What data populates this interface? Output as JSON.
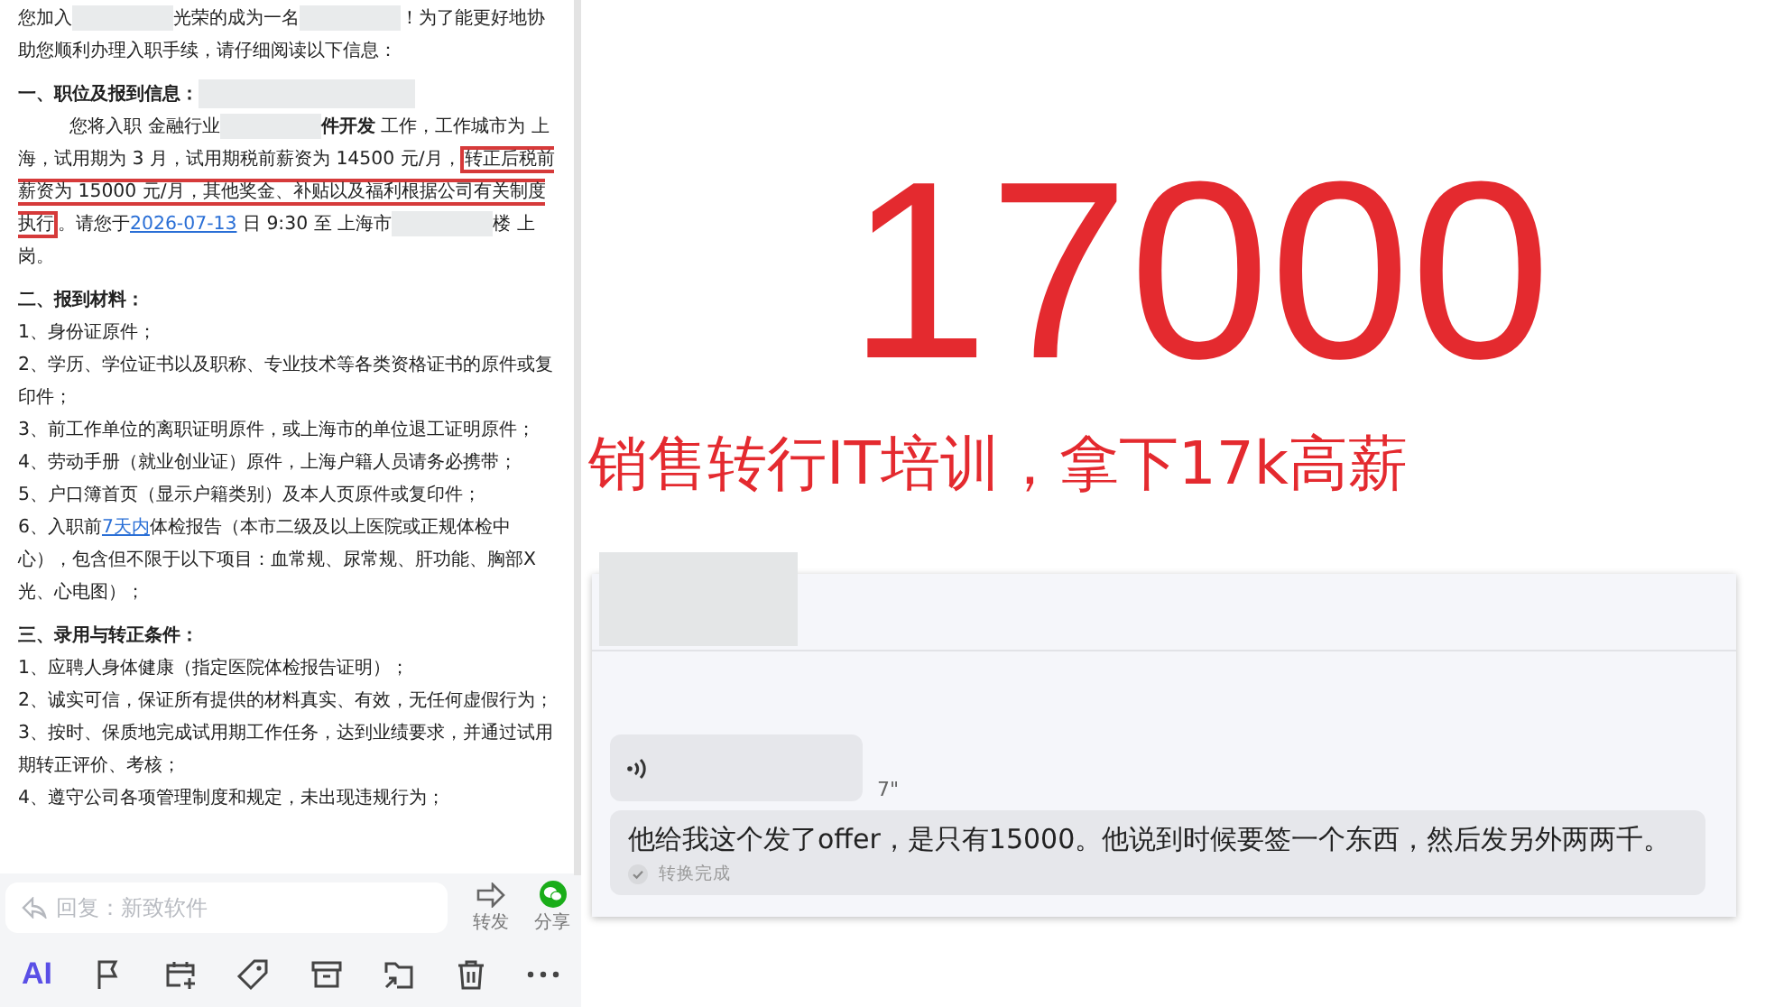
{
  "email": {
    "blocks": [
      {
        "kind": "para",
        "parts": [
          {
            "kind": "text",
            "text": "您加入"
          },
          {
            "kind": "redacted"
          },
          {
            "kind": "text",
            "text": "光荣的成为一名"
          },
          {
            "kind": "redacted"
          },
          {
            "kind": "text",
            "text": "！为了能更好地协助您顺利办理入职手续，请仔细阅读以下信息："
          }
        ]
      },
      {
        "kind": "heading",
        "parts": [
          {
            "kind": "text",
            "text": "一、职位及报到信息："
          },
          {
            "kind": "redacted"
          }
        ]
      },
      {
        "kind": "indented",
        "parts": [
          {
            "kind": "text",
            "text": "您将入职 金融行业"
          },
          {
            "kind": "redacted"
          },
          {
            "kind": "text",
            "text": "**件开发** 工作，工作城市为 上海，试用期为 3 月，试用期税前薪资为 14500 元/月，"
          },
          {
            "kind": "highlight",
            "text": "转正后税前薪资为 15000 元/月，其他奖金、补贴以及福利根据公司有关制度执行"
          },
          {
            "kind": "text",
            "text": "。请您于"
          },
          {
            "kind": "link",
            "text": "2026-07-13"
          },
          {
            "kind": "text",
            "text": " 日 9:30 至 上海市"
          },
          {
            "kind": "redacted"
          },
          {
            "kind": "text",
            "text": "楼 上岗。"
          }
        ]
      },
      {
        "kind": "heading",
        "parts": [
          {
            "kind": "text",
            "text": "二、报到材料："
          }
        ]
      },
      {
        "kind": "item",
        "parts": [
          {
            "kind": "text",
            "text": "1、身份证原件；"
          }
        ]
      },
      {
        "kind": "item",
        "parts": [
          {
            "kind": "text",
            "text": "2、学历、学位证书以及职称、专业技术等各类资格证书的原件或复印件；"
          }
        ]
      },
      {
        "kind": "item",
        "parts": [
          {
            "kind": "text",
            "text": "3、前工作单位的离职证明原件，或上海市的单位退工证明原件；"
          }
        ]
      },
      {
        "kind": "item",
        "parts": [
          {
            "kind": "text",
            "text": "4、劳动手册（就业创业证）原件，上海户籍人员请务必携带；"
          }
        ]
      },
      {
        "kind": "item",
        "parts": [
          {
            "kind": "text",
            "text": "5、户口簿首页（显示户籍类别）及本人页原件或复印件；"
          }
        ]
      },
      {
        "kind": "item",
        "parts": [
          {
            "kind": "text",
            "text": "6、入职前"
          },
          {
            "kind": "link",
            "text": "7天内"
          },
          {
            "kind": "text",
            "text": "体检报告（本市二级及以上医院或正规体检中心），包含但不限于以下项目：血常规、尿常规、肝功能、胸部X光、心电图）；"
          }
        ]
      },
      {
        "kind": "heading",
        "parts": [
          {
            "kind": "text",
            "text": "三、录用与转正条件："
          }
        ]
      },
      {
        "kind": "item",
        "parts": [
          {
            "kind": "text",
            "text": "1、应聘人身体健康（指定医院体检报告证明）；"
          }
        ]
      },
      {
        "kind": "item",
        "parts": [
          {
            "kind": "text",
            "text": "2、诚实可信，保证所有提供的材料真实、有效，无任何虚假行为；"
          }
        ]
      },
      {
        "kind": "item",
        "parts": [
          {
            "kind": "text",
            "text": "3、按时、保质地完成试用期工作任务，达到业绩要求，并通过试用期转正评价、考核；"
          }
        ]
      },
      {
        "kind": "item",
        "parts": [
          {
            "kind": "text",
            "text": "4、遵守公司各项管理制度和规定，未出现违规行为；"
          }
        ]
      }
    ]
  },
  "reply": {
    "placeholder": "回复：新致软件"
  },
  "actions": [
    {
      "kind": "forward",
      "label": "转发"
    },
    {
      "kind": "share",
      "label": "分享"
    }
  ],
  "toolbar": [
    {
      "kind": "ai",
      "label": "AI"
    },
    {
      "kind": "flag"
    },
    {
      "kind": "calendar"
    },
    {
      "kind": "tag"
    },
    {
      "kind": "archive"
    },
    {
      "kind": "move"
    },
    {
      "kind": "trash"
    },
    {
      "kind": "more"
    }
  ],
  "headline": "17000",
  "subtitle": "销售转行IT培训，拿下17k高薪",
  "chat": {
    "voice": {
      "duration": "7\""
    },
    "transcript": "他给我这个发了offer，是只有15000。他说到时候要签一个东西，然后发另外两两千。",
    "status": "转换完成"
  }
}
